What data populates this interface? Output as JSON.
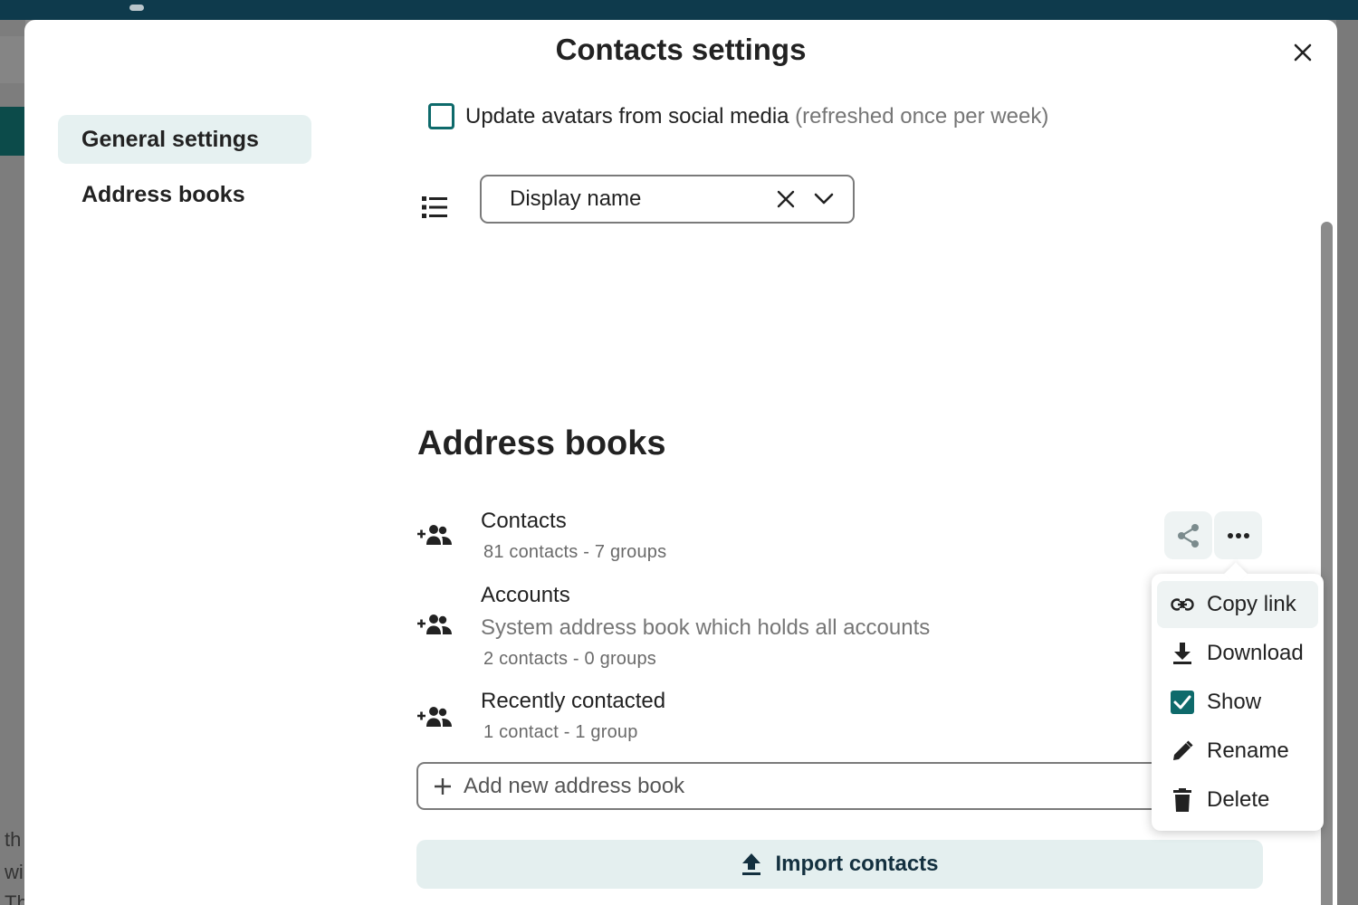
{
  "background": {
    "left_text_lines": [
      "th",
      "wi",
      "The"
    ]
  },
  "modal": {
    "title": "Contacts settings",
    "close_icon": "close-icon"
  },
  "nav": {
    "items": [
      {
        "label": "General settings",
        "active": true
      },
      {
        "label": "Address books",
        "active": false
      }
    ]
  },
  "general": {
    "avatar_checkbox": {
      "label": "Update avatars from social media",
      "hint": "(refreshed once per week)",
      "checked": false
    },
    "sort": {
      "icon": "list-sort-icon",
      "value": "Display name"
    }
  },
  "address_books": {
    "title": "Address books",
    "items": [
      {
        "name": "Contacts",
        "description": "",
        "meta": "81 contacts  - 7 groups",
        "icon": "group-add-icon"
      },
      {
        "name": "Accounts",
        "description": "System address book which holds all accounts",
        "meta": "2 contacts  - 0 groups",
        "icon": "group-add-icon"
      },
      {
        "name": "Recently contacted",
        "description": "",
        "meta": "1 contact  - 1 group",
        "icon": "group-add-icon"
      }
    ],
    "add_placeholder": "Add new address book",
    "import_label": "Import contacts"
  },
  "actions_menu": {
    "items": [
      {
        "label": "Copy link",
        "icon": "link-icon"
      },
      {
        "label": "Download",
        "icon": "download-icon"
      },
      {
        "label": "Show",
        "icon": "checkbox-checked-icon",
        "checked": true
      },
      {
        "label": "Rename",
        "icon": "pencil-icon"
      },
      {
        "label": "Delete",
        "icon": "trash-icon"
      }
    ]
  },
  "colors": {
    "accent": "#0e6a6b",
    "header_bar": "#0e3a4c",
    "active_nav_bg": "#e6f1f1",
    "import_bg": "#e4efef"
  }
}
